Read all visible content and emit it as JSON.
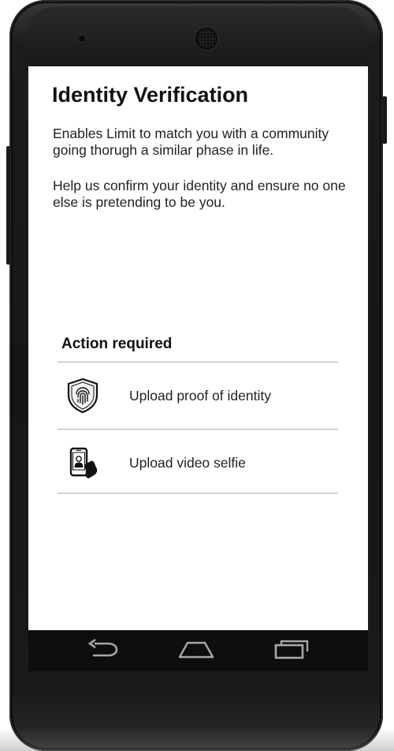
{
  "screen": {
    "title": "Identity Verification",
    "paragraphs": [
      "Enables Limit to match you with a community going thorugh a similar phase in life.",
      "Help us confirm your identity and ensure no one else is pretending to be you."
    ],
    "section_label": "Action required",
    "actions": [
      {
        "label": "Upload proof of identity",
        "icon": "fingerprint-shield-icon"
      },
      {
        "label": "Upload video selfie",
        "icon": "phone-selfie-icon"
      }
    ]
  },
  "navbar": {
    "buttons": [
      {
        "icon": "back-icon"
      },
      {
        "icon": "home-icon"
      },
      {
        "icon": "recent-apps-icon"
      }
    ]
  }
}
